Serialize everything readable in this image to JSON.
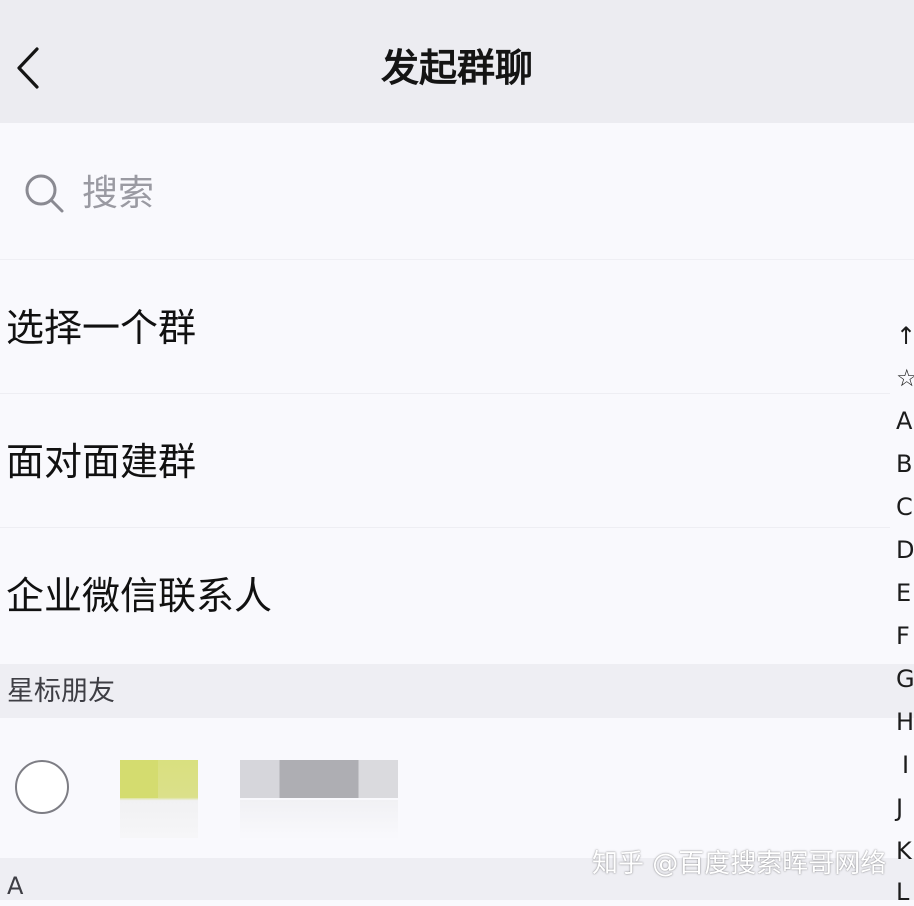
{
  "header": {
    "title": "发起群聊",
    "back_icon": "chevron-left-icon"
  },
  "search": {
    "placeholder": "搜索",
    "icon": "search-icon"
  },
  "menu": {
    "items": [
      {
        "label": "选择一个群"
      },
      {
        "label": "面对面建群"
      },
      {
        "label": "企业微信联系人"
      }
    ]
  },
  "sections": {
    "starred": "星标朋友",
    "a": "A"
  },
  "index_bar": {
    "letters": [
      "↑",
      "☆",
      "A",
      "B",
      "C",
      "D",
      "E",
      "F",
      "G",
      "H",
      "I",
      "J",
      "K",
      "L"
    ]
  },
  "watermark": "知乎 @百度搜索晖哥网络",
  "colors": {
    "nav_bg": "#ececf1",
    "page_bg": "#f9f9fd",
    "section_bg": "#eeeef3",
    "placeholder": "#9a9aa2"
  }
}
